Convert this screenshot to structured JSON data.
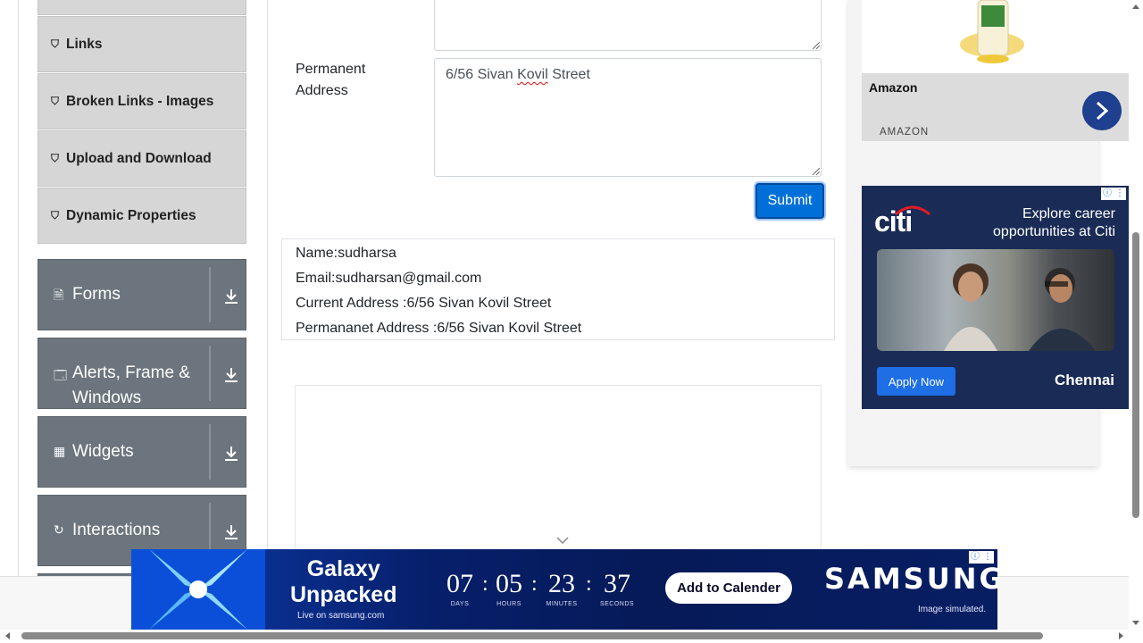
{
  "sidebar": {
    "items": [
      {
        "label": "Links",
        "icon": "html5-icon"
      },
      {
        "label": "Broken Links - Images",
        "icon": "html5-icon"
      },
      {
        "label": "Upload and Download",
        "icon": "html5-icon"
      },
      {
        "label": "Dynamic Properties",
        "icon": "html5-icon"
      }
    ],
    "groups": [
      {
        "label": "Forms",
        "icon": "form-icon"
      },
      {
        "label_line1": "Alerts, Frame &",
        "label_line2": "Windows",
        "icon": "window-icon"
      },
      {
        "label": "Widgets",
        "icon": "widgets-icon"
      },
      {
        "label": "Interactions",
        "icon": "interactions-icon"
      }
    ]
  },
  "form": {
    "permanent_label_line1": "Permanent",
    "permanent_label_line2": "Address",
    "permanent_value_pre": "6/56 Sivan ",
    "permanent_value_misspelled": "Kovil",
    "permanent_value_post": " Street",
    "submit_label": "Submit"
  },
  "output": {
    "name": "Name:sudharsa",
    "email": "Email:sudharsan@gmail.com",
    "current_address": "Current Address :6/56 Sivan Kovil Street",
    "permanent_address": "Permananet Address :6/56 Sivan Kovil Street"
  },
  "ads": {
    "amazon": {
      "title": "Amazon",
      "source": "AMAZON"
    },
    "citi": {
      "logo": "citi",
      "headline_line1": "Explore career",
      "headline_line2": "opportunities at Citi",
      "cta": "Apply Now",
      "city": "Chennai"
    },
    "samsung": {
      "title_line1": "Galaxy",
      "title_line2": "Unpacked",
      "subtitle": "Live on samsung.com",
      "countdown": [
        {
          "value": "07",
          "unit": "DAYS"
        },
        {
          "value": "05",
          "unit": "HOURS"
        },
        {
          "value": "23",
          "unit": "MINUTES"
        },
        {
          "value": "37",
          "unit": "SECONDS"
        }
      ],
      "cta": "Add to Calender",
      "brand": "SAMSUNG",
      "disclaimer": "Image simulated."
    }
  },
  "colors": {
    "submit": "#0070d8",
    "sidebar_group": "#6c757d",
    "sidebar_item": "#d6d6d6"
  }
}
